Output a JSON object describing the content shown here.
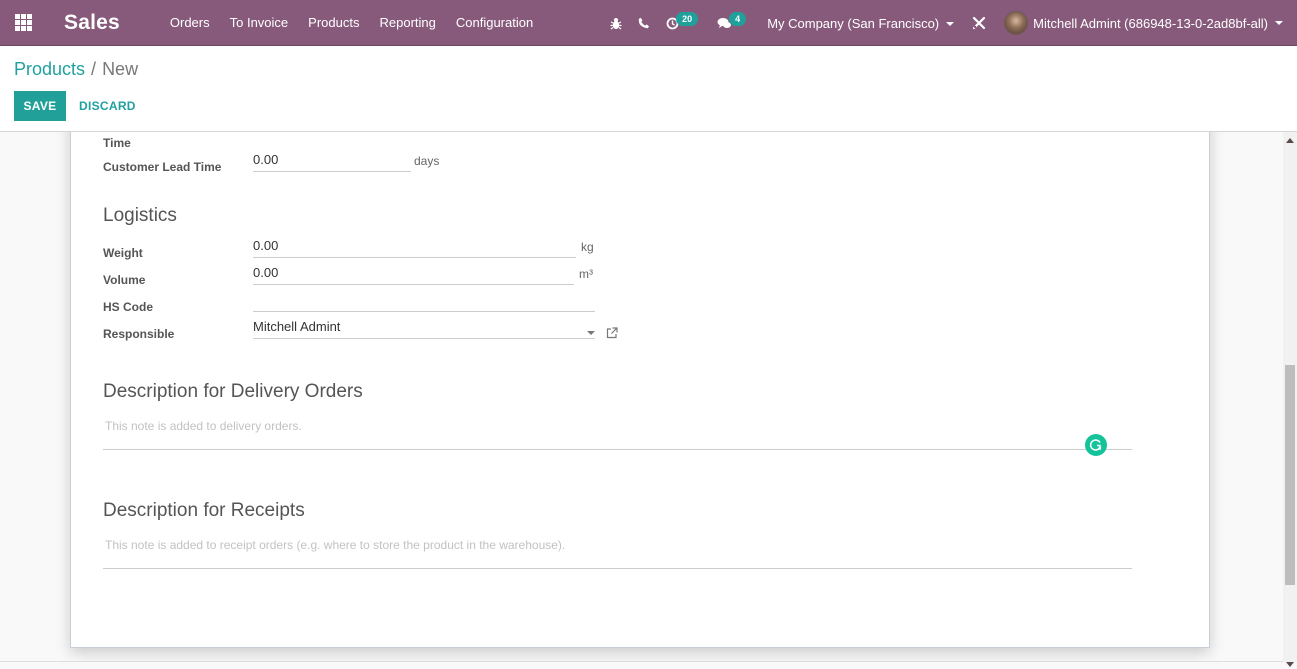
{
  "navbar": {
    "app_name": "Sales",
    "menu": [
      "Orders",
      "To Invoice",
      "Products",
      "Reporting",
      "Configuration"
    ],
    "activity_count": "20",
    "messages_count": "4",
    "company": "My Company (San Francisco)",
    "user": "Mitchell Admint (686948-13-0-2ad8bf-all)"
  },
  "breadcrumb": {
    "parent": "Products",
    "separator": "/",
    "current": "New"
  },
  "buttons": {
    "save": "SAVE",
    "discard": "DISCARD"
  },
  "form": {
    "partial_label": "Time",
    "customer_lead_time": {
      "label": "Customer Lead Time",
      "value": "0.00",
      "unit": "days"
    },
    "logistics": {
      "title": "Logistics",
      "weight": {
        "label": "Weight",
        "value": "0.00",
        "unit": "kg"
      },
      "volume": {
        "label": "Volume",
        "value": "0.00",
        "unit": "m³"
      },
      "hs_code": {
        "label": "HS Code",
        "value": ""
      },
      "responsible": {
        "label": "Responsible",
        "value": "Mitchell Admint"
      }
    },
    "delivery_description": {
      "title": "Description for Delivery Orders",
      "placeholder": "This note is added to delivery orders."
    },
    "receipt_description": {
      "title": "Description for Receipts",
      "placeholder": "This note is added to receipt orders (e.g. where to store the product in the warehouse)."
    }
  },
  "colors": {
    "navbar": "#875a7b",
    "primary": "#21a09a",
    "badge": "#20a09a",
    "grammarly": "#15c39a"
  }
}
